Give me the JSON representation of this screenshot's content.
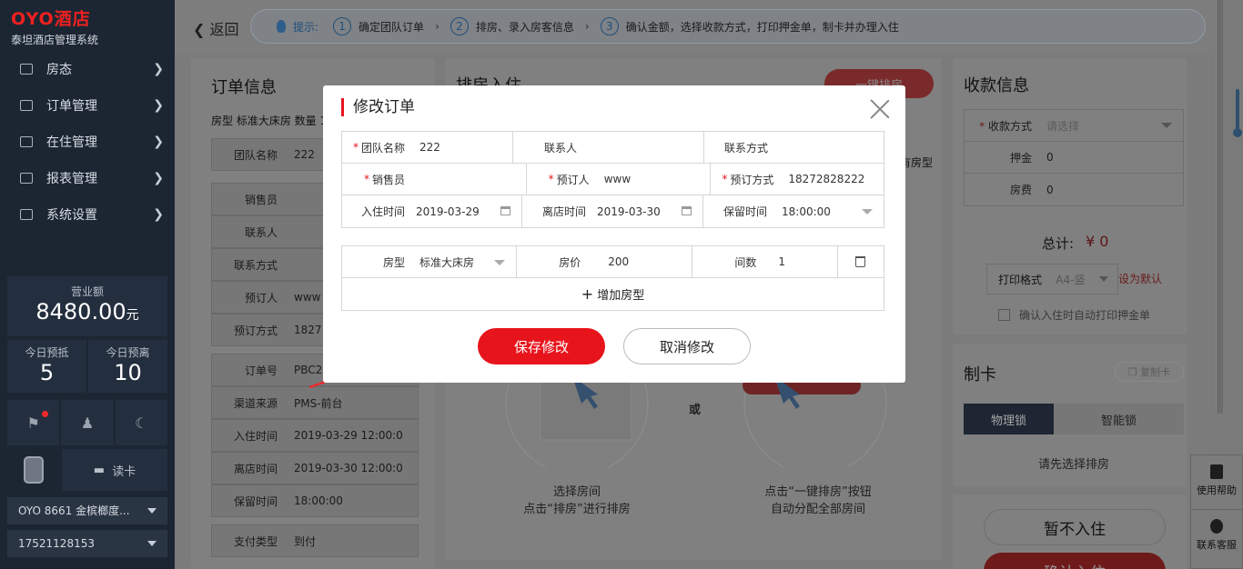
{
  "app": {
    "logo": "OYO酒店",
    "system_name": "泰坦酒店管理系统"
  },
  "sidebar": {
    "items": [
      {
        "label": "房态",
        "icon": "grid-icon"
      },
      {
        "label": "订单管理",
        "icon": "document-icon"
      },
      {
        "label": "在住管理",
        "icon": "bed-icon"
      },
      {
        "label": "报表管理",
        "icon": "chart-icon"
      },
      {
        "label": "系统设置",
        "icon": "monitor-icon"
      }
    ],
    "revenue_label": "营业额",
    "revenue_value": "8480.00",
    "revenue_unit": "元",
    "arrive_label": "今日预抵",
    "arrive_value": "5",
    "depart_label": "今日预离",
    "depart_value": "10",
    "read_card": "读卡",
    "hotel_select": "OYO 8661 金槟榔度...",
    "phone_select": "17521128153"
  },
  "topbar": {
    "back": "返回",
    "tip_label": "提示:",
    "steps": [
      {
        "num": "1",
        "text": "确定团队订单"
      },
      {
        "num": "2",
        "text": "排房、录入房客信息"
      },
      {
        "num": "3",
        "text": "确认金额，选择收款方式，打印押金单，制卡并办理入住"
      }
    ]
  },
  "order_panel": {
    "title": "订单信息",
    "summary": "房型 标准大床房 数量 1",
    "rows1": [
      {
        "k": "团队名称",
        "v": "222"
      }
    ],
    "rows2": [
      {
        "k": "销售员",
        "v": ""
      },
      {
        "k": "联系人",
        "v": ""
      },
      {
        "k": "联系方式",
        "v": ""
      },
      {
        "k": "预订人",
        "v": "www"
      },
      {
        "k": "预订方式",
        "v": "1827"
      }
    ],
    "rows3": [
      {
        "k": "订单号",
        "v": "PBC2"
      },
      {
        "k": "渠道来源",
        "v": "PMS-前台"
      },
      {
        "k": "入住时间",
        "v": "2019-03-29 12:00:0"
      },
      {
        "k": "离店时间",
        "v": "2019-03-30 12:00:0"
      },
      {
        "k": "保留时间",
        "v": "18:00:00"
      }
    ],
    "rows4": [
      {
        "k": "支付类型",
        "v": "到付"
      }
    ]
  },
  "assign_panel": {
    "title": "排房入住",
    "one_click": "一键排房",
    "side_text": "有房型",
    "or": "或",
    "hint_left_1": "选择房间",
    "hint_left_2": "点击“排房”进行排房",
    "hint_right_1": "点击“一键排房”按钮",
    "hint_right_2": "自动分配全部房间"
  },
  "payment_panel": {
    "title": "收款信息",
    "method_label": "收款方式",
    "method_placeholder": "请选择",
    "deposit_label": "押金",
    "deposit_value": "0",
    "room_fee_label": "房费",
    "room_fee_value": "0",
    "total_label": "总计:",
    "total_value": "¥ 0",
    "print_format_label": "打印格式",
    "print_format_value": "A4-竖",
    "set_default": "设为默认",
    "auto_print": "确认入住时自动打印押金单"
  },
  "card_panel": {
    "title": "制卡",
    "copy_card": "复制卡",
    "tab_physical": "物理锁",
    "tab_smart": "智能锁",
    "empty_hint": "请先选择排房"
  },
  "actions": {
    "not_checkin": "暂不入住",
    "confirm_checkin": "确认入住"
  },
  "float_help": {
    "help": "使用帮助",
    "service": "联系客服"
  },
  "modal": {
    "title": "修改订单",
    "fields": {
      "team_name_label": "团队名称",
      "team_name_value": "222",
      "contact_label": "联系人",
      "contact_value": "",
      "contact_method_label": "联系方式",
      "contact_method_value": "",
      "sales_label": "销售员",
      "sales_value": "",
      "booker_label": "预订人",
      "booker_value": "www",
      "booking_method_label": "预订方式",
      "booking_method_value": "18272828222",
      "checkin_label": "入住时间",
      "checkin_value": "2019-03-29",
      "checkout_label": "离店时间",
      "checkout_value": "2019-03-30",
      "hold_label": "保留时间",
      "hold_value": "18:00:00"
    },
    "room": {
      "type_label": "房型",
      "type_value": "标准大床房",
      "price_label": "房价",
      "price_value": "200",
      "count_label": "间数",
      "count_value": "1"
    },
    "add_room_type": "增加房型",
    "save": "保存修改",
    "cancel": "取消修改"
  },
  "colors": {
    "accent": "#e8141c",
    "sidebar_bg": "#1c2633",
    "overlay": "#7b7b7b"
  }
}
